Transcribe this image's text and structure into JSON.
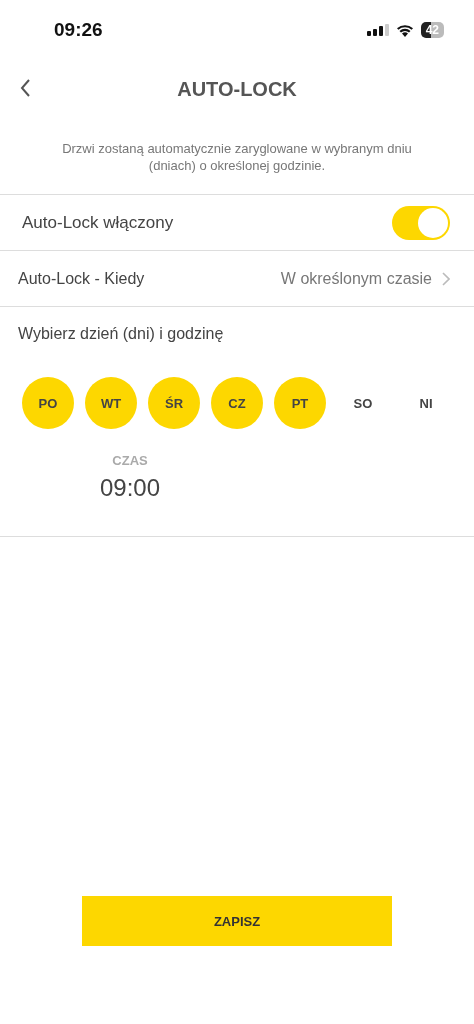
{
  "status_bar": {
    "time": "09:26",
    "battery": "42"
  },
  "header": {
    "title": "AUTO-LOCK"
  },
  "description": "Drzwi zostaną automatycznie zaryglowane w wybranym dniu (dniach) o określonej godzinie.",
  "auto_lock": {
    "label": "Auto-Lock włączony",
    "on": true
  },
  "when": {
    "label": "Auto-Lock - Kiedy",
    "value": "W określonym czasie"
  },
  "schedule_heading": "Wybierz dzień (dni) i godzinę",
  "days": [
    {
      "label": "PO",
      "selected": true
    },
    {
      "label": "WT",
      "selected": true
    },
    {
      "label": "ŚR",
      "selected": true
    },
    {
      "label": "CZ",
      "selected": true
    },
    {
      "label": "PT",
      "selected": true
    },
    {
      "label": "SO",
      "selected": false
    },
    {
      "label": "NI",
      "selected": false
    }
  ],
  "time": {
    "label": "CZAS",
    "value": "09:00"
  },
  "save_button": "ZAPISZ"
}
